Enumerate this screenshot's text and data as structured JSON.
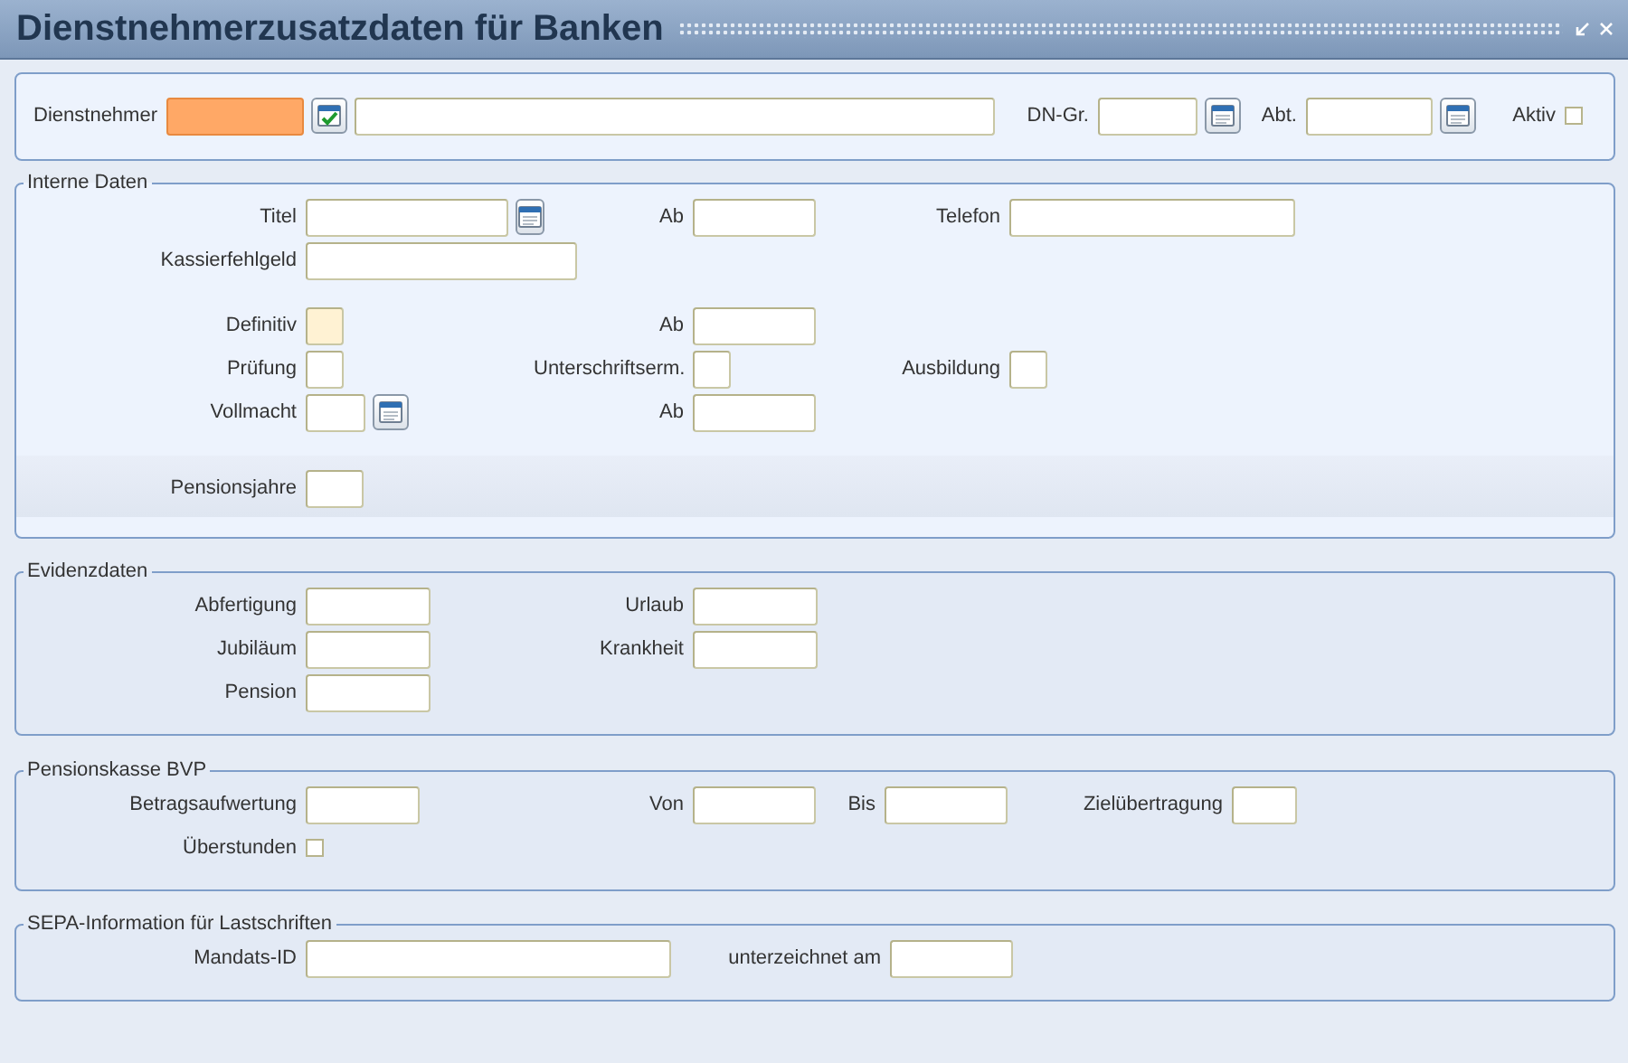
{
  "window": {
    "title": "Dienstnehmerzusatzdaten für Banken"
  },
  "sections": [
    {
      "blocks": [
        {
          "rows": [
            {
              "groups": [
                {
                  "label": "Dienstnehmer",
                  "controls": [
                    {
                      "kind": "input-active"
                    },
                    {
                      "kind": "lookup-button"
                    },
                    {
                      "kind": "input"
                    }
                  ]
                },
                {
                  "label": "DN-Gr.",
                  "controls": [
                    {
                      "kind": "input"
                    },
                    {
                      "kind": "date-button"
                    }
                  ]
                },
                {
                  "label": "Abt.",
                  "controls": [
                    {
                      "kind": "input"
                    },
                    {
                      "kind": "date-button"
                    }
                  ]
                },
                {
                  "label": "Aktiv",
                  "controls": [
                    {
                      "kind": "checkbox",
                      "checked": false
                    }
                  ]
                }
              ]
            }
          ]
        }
      ]
    },
    {
      "title": "Interne Daten",
      "blocks": [
        {
          "rows": [
            {
              "groups": [
                {
                  "label": "Titel",
                  "controls": [
                    {
                      "kind": "input"
                    },
                    {
                      "kind": "date-button"
                    }
                  ]
                },
                {
                  "label": "Ab",
                  "controls": [
                    {
                      "kind": "input"
                    }
                  ]
                },
                {
                  "label": "Telefon",
                  "controls": [
                    {
                      "kind": "input"
                    }
                  ]
                }
              ]
            },
            {
              "groups": [
                {
                  "label": "Kassierfehlgeld",
                  "controls": [
                    {
                      "kind": "input"
                    }
                  ]
                }
              ]
            }
          ]
        },
        {
          "rows": [
            {
              "groups": [
                {
                  "label": "Definitiv",
                  "controls": [
                    {
                      "kind": "input-marked"
                    }
                  ]
                },
                {
                  "label": "Ab",
                  "controls": [
                    {
                      "kind": "input"
                    }
                  ]
                }
              ]
            },
            {
              "groups": [
                {
                  "label": "Prüfung",
                  "controls": [
                    {
                      "kind": "input"
                    }
                  ]
                },
                {
                  "label": "Unterschriftserm.",
                  "controls": [
                    {
                      "kind": "input"
                    }
                  ]
                },
                {
                  "label": "Ausbildung",
                  "controls": [
                    {
                      "kind": "input"
                    }
                  ]
                }
              ]
            },
            {
              "groups": [
                {
                  "label": "Vollmacht",
                  "controls": [
                    {
                      "kind": "input"
                    },
                    {
                      "kind": "date-button"
                    }
                  ]
                },
                {
                  "label": "Ab",
                  "controls": [
                    {
                      "kind": "input"
                    }
                  ]
                }
              ]
            }
          ]
        },
        {
          "rows": [
            {
              "groups": [
                {
                  "label": "Pensionsjahre",
                  "controls": [
                    {
                      "kind": "input"
                    }
                  ]
                }
              ]
            }
          ]
        }
      ]
    },
    {
      "title": "Evidenzdaten",
      "blocks": [
        {
          "rows": [
            {
              "groups": [
                {
                  "label": "Abfertigung",
                  "controls": [
                    {
                      "kind": "input"
                    }
                  ]
                },
                {
                  "label": "Urlaub",
                  "controls": [
                    {
                      "kind": "input"
                    }
                  ]
                }
              ]
            },
            {
              "groups": [
                {
                  "label": "Jubiläum",
                  "controls": [
                    {
                      "kind": "input"
                    }
                  ]
                },
                {
                  "label": "Krankheit",
                  "controls": [
                    {
                      "kind": "input"
                    }
                  ]
                }
              ]
            },
            {
              "groups": [
                {
                  "label": "Pension",
                  "controls": [
                    {
                      "kind": "input"
                    }
                  ]
                }
              ]
            }
          ]
        }
      ]
    },
    {
      "title": "Pensionskasse BVP",
      "blocks": [
        {
          "rows": [
            {
              "groups": [
                {
                  "label": "Betragsaufwertung",
                  "controls": [
                    {
                      "kind": "input"
                    }
                  ]
                },
                {
                  "label": "Von",
                  "controls": [
                    {
                      "kind": "input"
                    }
                  ]
                },
                {
                  "label": "Bis",
                  "controls": [
                    {
                      "kind": "input"
                    }
                  ]
                },
                {
                  "label": "Zielübertragung",
                  "controls": [
                    {
                      "kind": "input"
                    }
                  ]
                }
              ]
            },
            {
              "groups": [
                {
                  "label": "Überstunden",
                  "controls": [
                    {
                      "kind": "checkbox",
                      "checked": false
                    }
                  ]
                }
              ]
            }
          ]
        }
      ]
    },
    {
      "title": "SEPA-Information für Lastschriften",
      "blocks": [
        {
          "rows": [
            {
              "groups": [
                {
                  "label": "Mandats-ID",
                  "controls": [
                    {
                      "kind": "input"
                    }
                  ]
                },
                {
                  "label": "unterzeichnet am",
                  "controls": [
                    {
                      "kind": "input"
                    }
                  ]
                }
              ]
            }
          ]
        }
      ]
    }
  ]
}
